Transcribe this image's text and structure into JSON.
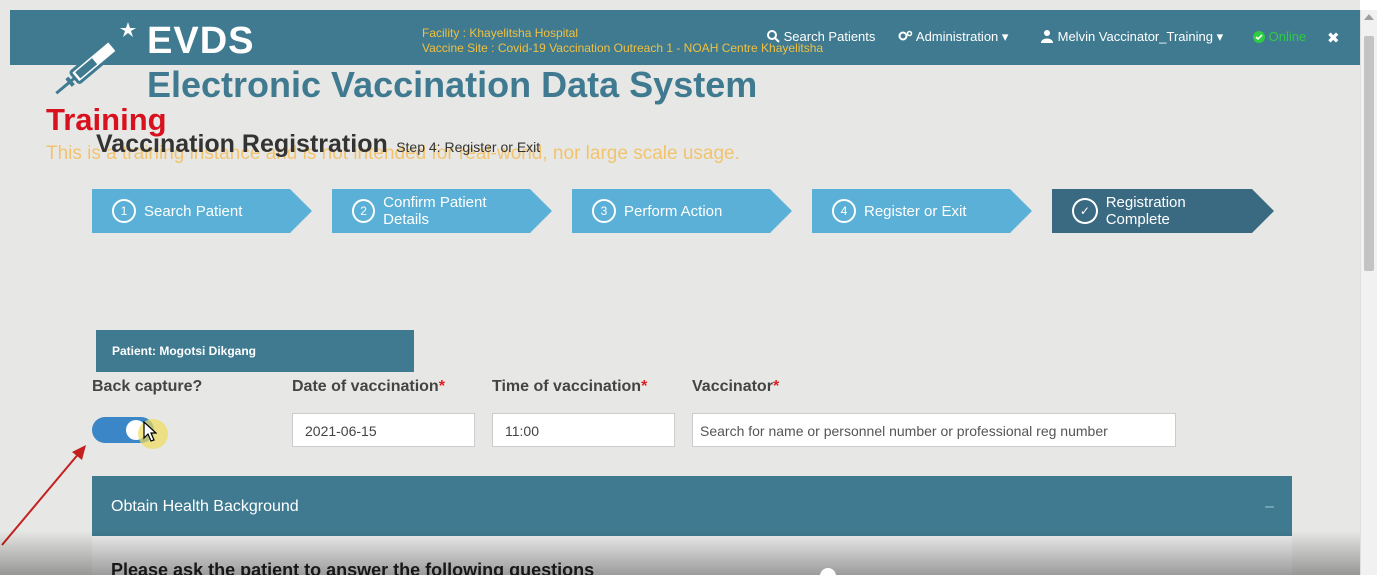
{
  "header": {
    "brand": "EVDS",
    "facility_line": "Facility : Khayelitsha Hospital",
    "site_line": "Vaccine Site : Covid-19 Vaccination Outreach 1 - NOAH Centre Khayelitsha",
    "nav": {
      "search": "Search Patients",
      "admin": "Administration",
      "user": "Melvin Vaccinator_Training",
      "status": "Online"
    }
  },
  "system_title": "Electronic Vaccination Data System",
  "training_label": "Training",
  "training_warning": "This is a training instance and is not intended for real-world, nor large scale usage.",
  "page": {
    "title": "Vaccination Registration",
    "subtitle": "Step 4: Register or Exit"
  },
  "steps": [
    {
      "num": "1",
      "label": "Search Patient"
    },
    {
      "num": "2",
      "label": "Confirm Patient Details"
    },
    {
      "num": "3",
      "label": "Perform Action"
    },
    {
      "num": "4",
      "label": "Register or Exit"
    },
    {
      "num": "",
      "label": "Registration Complete"
    }
  ],
  "patient": {
    "label": "Patient: Mogotsi Dikgang"
  },
  "form": {
    "back_capture_label": "Back capture?",
    "back_capture_on": true,
    "date_label": "Date of vaccination",
    "date_value": "2021-06-15",
    "time_label": "Time of vaccination",
    "time_value": "11:00",
    "vaccinator_label": "Vaccinator",
    "vaccinator_placeholder": "Search for name or personnel number or professional reg number",
    "required_mark": "*"
  },
  "health": {
    "title": "Obtain Health Background",
    "collapse": "–",
    "instruction": "Please ask the patient to answer the following questions"
  },
  "colors": {
    "brand": "#3f7a90",
    "step": "#5ab0d6",
    "step_done": "#3a6a82",
    "required": "#e02020",
    "training": "#d9111e",
    "online": "#2ecc40"
  }
}
